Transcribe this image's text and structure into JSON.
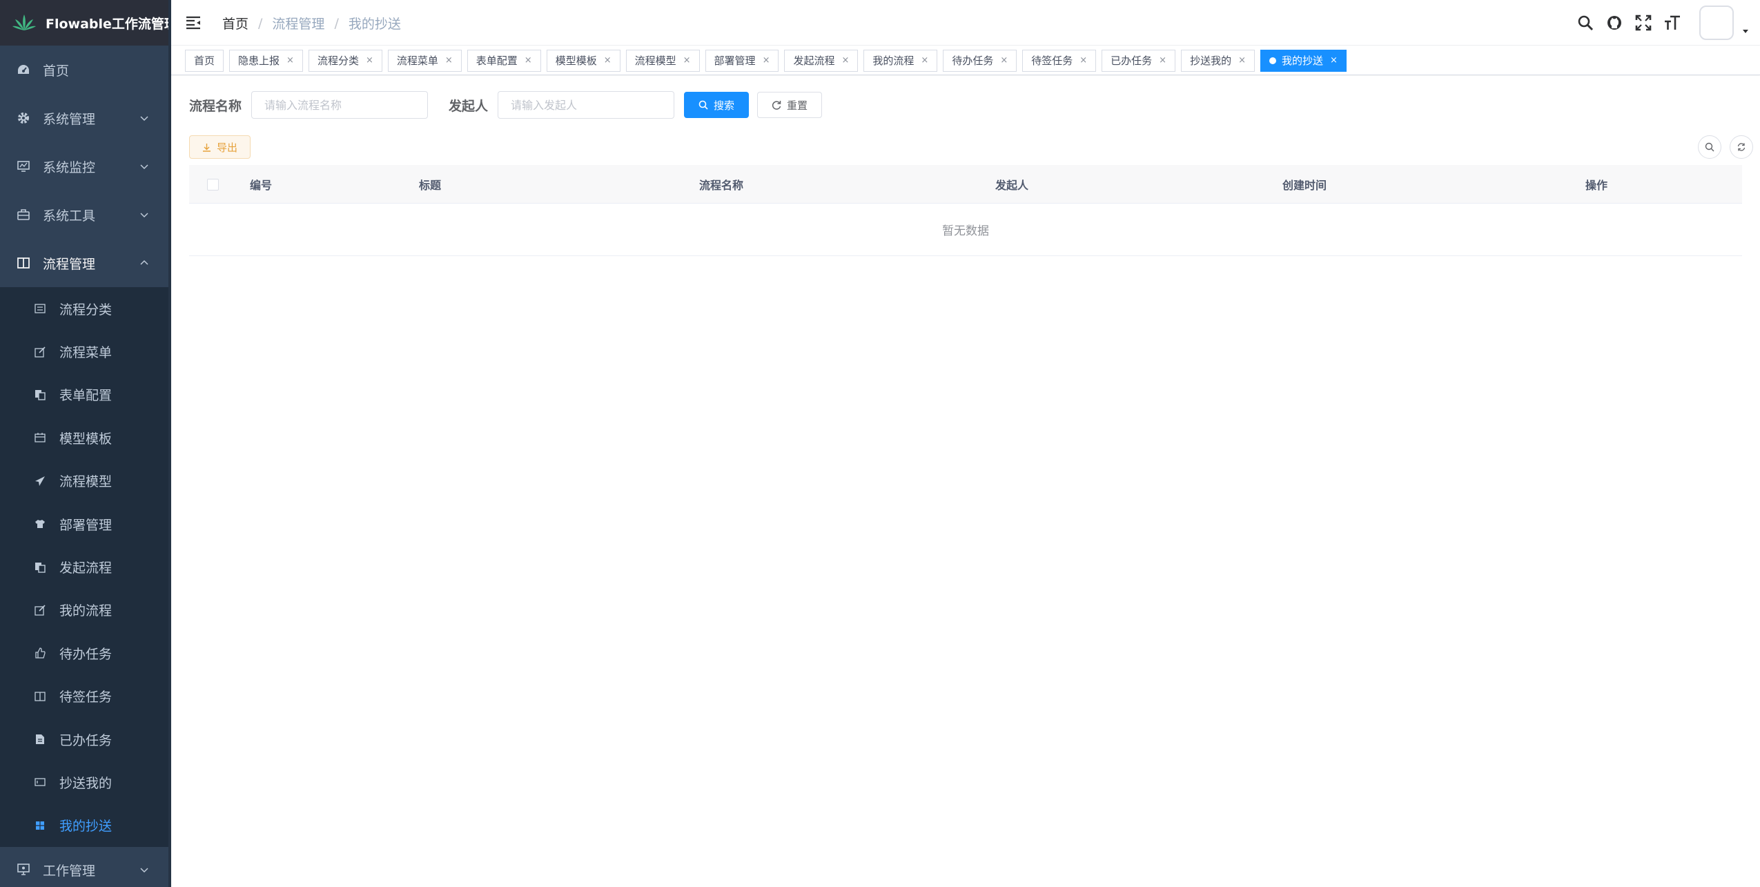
{
  "app": {
    "title": "Flowable工作流管理"
  },
  "sidebar": {
    "items": [
      {
        "label": "首页",
        "icon": "dashboard-icon"
      },
      {
        "label": "系统管理",
        "icon": "gear-icon"
      },
      {
        "label": "系统监控",
        "icon": "monitor-icon"
      },
      {
        "label": "系统工具",
        "icon": "toolbox-icon"
      },
      {
        "label": "流程管理",
        "icon": "book-icon"
      }
    ],
    "submenu": [
      {
        "label": "流程分类"
      },
      {
        "label": "流程菜单"
      },
      {
        "label": "表单配置"
      },
      {
        "label": "模型模板"
      },
      {
        "label": "流程模型"
      },
      {
        "label": "部署管理"
      },
      {
        "label": "发起流程"
      },
      {
        "label": "我的流程"
      },
      {
        "label": "待办任务"
      },
      {
        "label": "待签任务"
      },
      {
        "label": "已办任务"
      },
      {
        "label": "抄送我的"
      },
      {
        "label": "我的抄送"
      }
    ],
    "bottom": {
      "label": "工作管理"
    }
  },
  "breadcrumb": {
    "home": "首页",
    "level1": "流程管理",
    "level2": "我的抄送"
  },
  "tags": [
    {
      "label": "首页"
    },
    {
      "label": "隐患上报"
    },
    {
      "label": "流程分类"
    },
    {
      "label": "流程菜单"
    },
    {
      "label": "表单配置"
    },
    {
      "label": "模型模板"
    },
    {
      "label": "流程模型"
    },
    {
      "label": "部署管理"
    },
    {
      "label": "发起流程"
    },
    {
      "label": "我的流程"
    },
    {
      "label": "待办任务"
    },
    {
      "label": "待签任务"
    },
    {
      "label": "已办任务"
    },
    {
      "label": "抄送我的"
    },
    {
      "label": "我的抄送"
    }
  ],
  "tag_close": "×",
  "search": {
    "name_label": "流程名称",
    "name_placeholder": "请输入流程名称",
    "starter_label": "发起人",
    "starter_placeholder": "请输入发起人",
    "search_btn": "搜索",
    "reset_btn": "重置"
  },
  "toolbar": {
    "export_btn": "导出"
  },
  "table": {
    "columns": [
      "编号",
      "标题",
      "流程名称",
      "发起人",
      "创建时间",
      "操作"
    ],
    "empty_text": "暂无数据"
  },
  "colors": {
    "primary": "#1890ff",
    "sidebar_bg": "#304156",
    "submenu_bg": "#1f2d3d",
    "active_menu": "#409eff"
  }
}
